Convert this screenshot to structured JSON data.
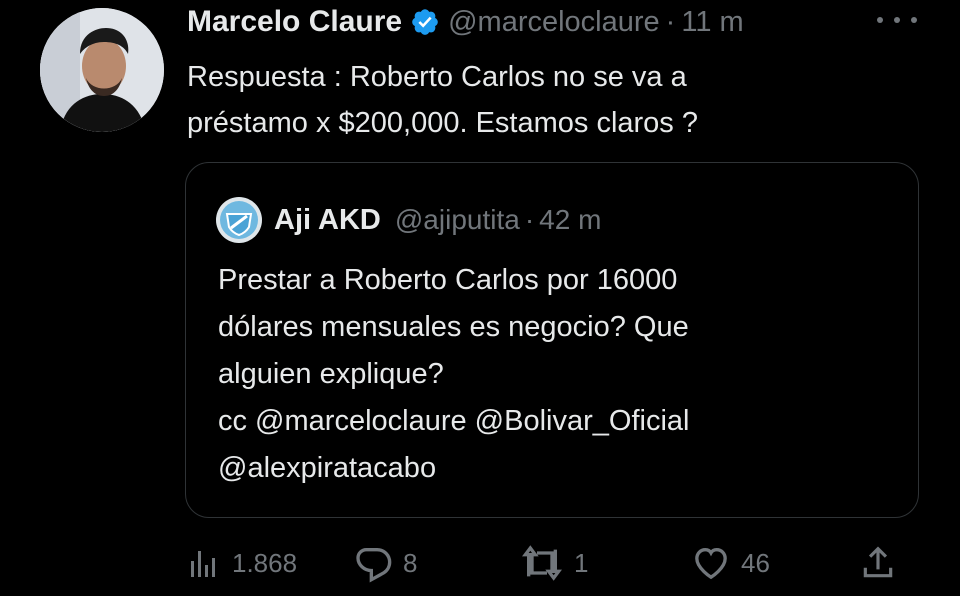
{
  "tweet": {
    "author_name": "Marcelo Claure",
    "author_handle": "@marceloclaure",
    "separator": "·",
    "time": "11 m",
    "text": "Respuesta : Roberto Carlos no se va a\npréstamo x $200,000.  Estamos claros ?",
    "verified": true
  },
  "quoted_tweet": {
    "author_name": "Aji AKD",
    "author_handle": "@ajiputita",
    "separator": "·",
    "time": "42 m",
    "text": "Prestar a Roberto Carlos por 16000\ndólares mensuales es negocio? Que\nalguien explique?\ncc @marceloclaure @Bolivar_Oficial\n@alexpiratacabo"
  },
  "actions": {
    "views": "1.868",
    "replies": "8",
    "retweets": "1",
    "likes": "46"
  },
  "icons": {
    "verified": "verified-badge-icon",
    "more": "more-options-icon",
    "views": "analytics-icon",
    "reply": "reply-icon",
    "retweet": "retweet-icon",
    "like": "heart-icon",
    "share": "share-icon"
  },
  "colors": {
    "background": "#000000",
    "text_primary": "#e7e9ea",
    "text_secondary": "#71767b",
    "border": "#2f3336",
    "verified_blue": "#1d9bf0"
  }
}
